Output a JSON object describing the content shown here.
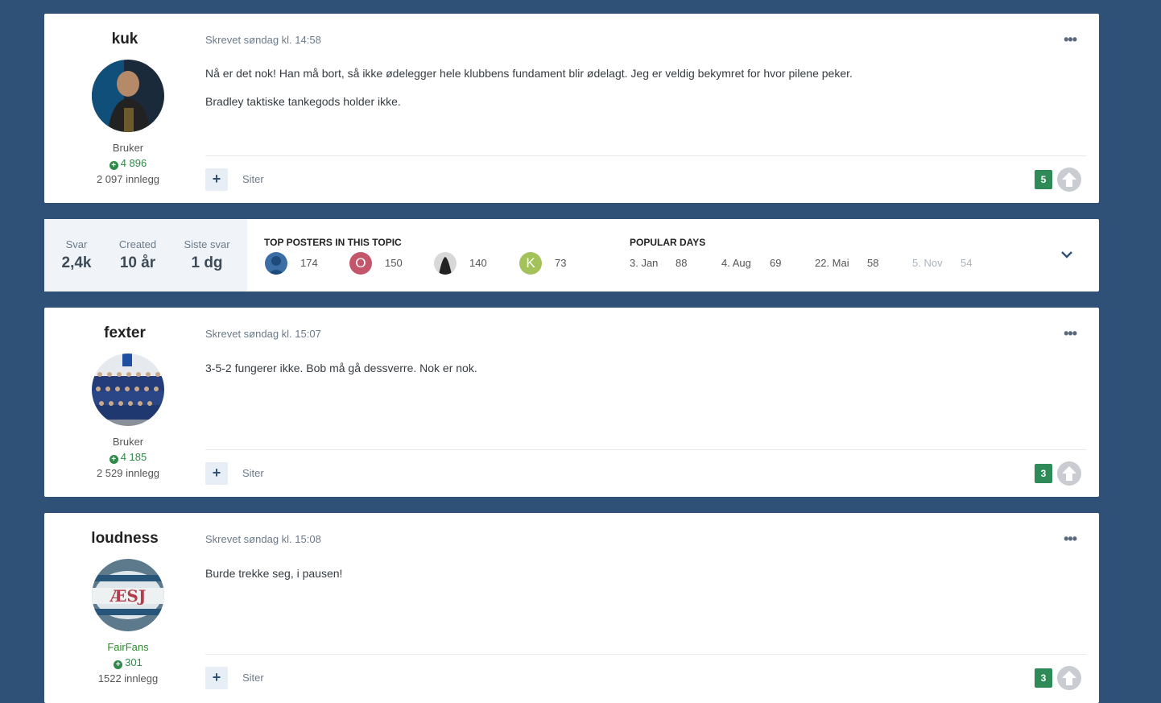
{
  "posts": [
    {
      "author": "kuk",
      "role": "Bruker",
      "reputation": "4 896",
      "post_count": "2 097 innlegg",
      "timestamp": "Skrevet søndag kl. 14:58",
      "paragraphs": [
        "Nå er det nok! Han må bort, så ikke ødelegger hele klubbens fundament blir ødelagt. Jeg er veldig bekymret for hvor pilene peker.",
        "Bradley taktiske tankegods holder ikke."
      ],
      "quote_label": "Siter",
      "reaction_count": "5"
    },
    {
      "author": "fexter",
      "role": "Bruker",
      "reputation": "4 185",
      "post_count": "2 529 innlegg",
      "timestamp": "Skrevet søndag kl. 15:07",
      "paragraphs": [
        "3-5-2 fungerer ikke. Bob må gå dessverre. Nok er nok."
      ],
      "quote_label": "Siter",
      "reaction_count": "3"
    },
    {
      "author": "loudness",
      "role": "FairFans",
      "reputation": "301",
      "post_count": "1522 innlegg",
      "timestamp": "Skrevet søndag kl. 15:08",
      "paragraphs": [
        "Burde trekke seg, i pausen!"
      ],
      "quote_label": "Siter",
      "reaction_count": "3"
    }
  ],
  "topic_stats": {
    "replies_label": "Svar",
    "replies_value": "2,4k",
    "created_label": "Created",
    "created_value": "10 år",
    "last_reply_label": "Siste svar",
    "last_reply_value": "1 dg",
    "top_posters_heading": "TOP POSTERS IN THIS TOPIC",
    "top_posters": [
      {
        "initial": "",
        "count": "174",
        "color": "#3a6ea5"
      },
      {
        "initial": "O",
        "count": "150",
        "color": "#c4566b"
      },
      {
        "initial": "",
        "count": "140",
        "color": "#333333"
      },
      {
        "initial": "K",
        "count": "73",
        "color": "#a3c25a"
      }
    ],
    "popular_days_heading": "POPULAR DAYS",
    "popular_days": [
      {
        "date": "3. Jan",
        "count": "88"
      },
      {
        "date": "4. Aug",
        "count": "69"
      },
      {
        "date": "22. Mai",
        "count": "58"
      },
      {
        "date": "5. Nov",
        "count": "54"
      }
    ]
  },
  "colors": {
    "background": "#2f5077",
    "reaction_badge": "#2e8b57",
    "reputation": "#2f8a4a"
  },
  "icons": {
    "more": "more-options-icon",
    "add": "plus-icon",
    "upvote": "upvote-arrow-icon",
    "expand": "chevron-down-icon"
  }
}
